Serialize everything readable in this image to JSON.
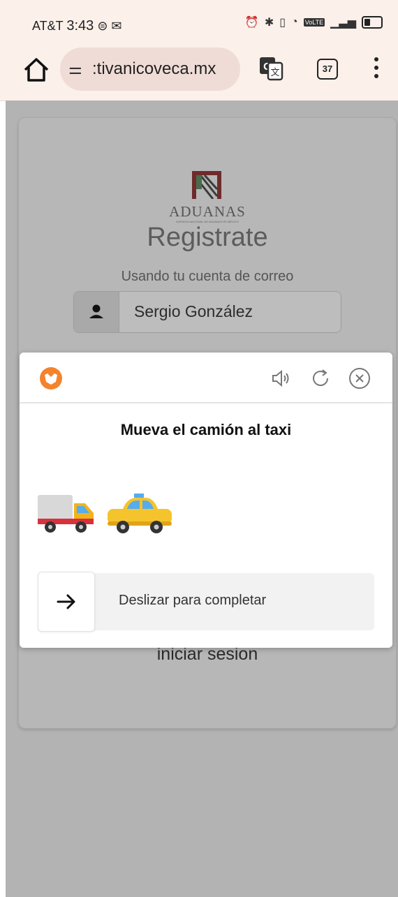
{
  "status_bar": {
    "carrier": "AT&T",
    "time": "3:43",
    "volte": "VoLTE"
  },
  "browser": {
    "url": ":tivanicoveca.mx",
    "tab_count": "37"
  },
  "page": {
    "logo_text": "ADUANAS",
    "logo_subtext": "AGENCIA NACIONAL DE ADUANAS DE MÉXICO",
    "title": "Registrate",
    "subtitle": "Usando tu cuenta de correo",
    "name_value": "Sergio González",
    "login_label": "iniciar sesion"
  },
  "captcha": {
    "instruction": "Mueva el camión al taxi",
    "slider_label": "Deslizar para completar",
    "colors": {
      "brand": "#f4832d",
      "truck_bed": "#d8d8d8",
      "truck_cab": "#f2b31c",
      "truck_stripe": "#d9303d",
      "taxi": "#f5c42c"
    }
  }
}
